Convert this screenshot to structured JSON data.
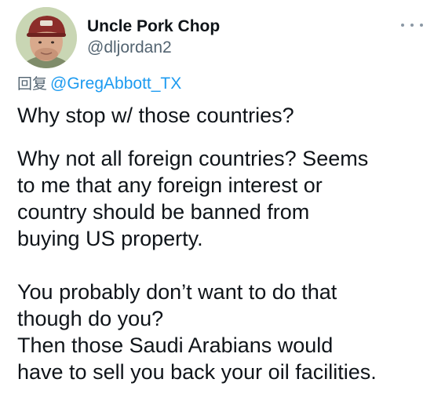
{
  "tweet": {
    "display_name": "Uncle Pork Chop",
    "handle": "@dljordan2",
    "more_icon": "more-horizontal-icon",
    "reply": {
      "label": "回复",
      "mention": "@GregAbbott_TX"
    },
    "paragraphs": [
      "Why stop w/ those countries?",
      "Why not all foreign countries? Seems\nto me that any foreign interest or\ncountry should be banned from\nbuying US property.",
      "You probably don’t want to do that\nthough do you?\nThen those Saudi Arabians would\nhave to sell you back your oil facilities."
    ]
  },
  "colors": {
    "text": "#0f1419",
    "secondary": "#536471",
    "link": "#1d9bf0",
    "background": "#ffffff"
  }
}
